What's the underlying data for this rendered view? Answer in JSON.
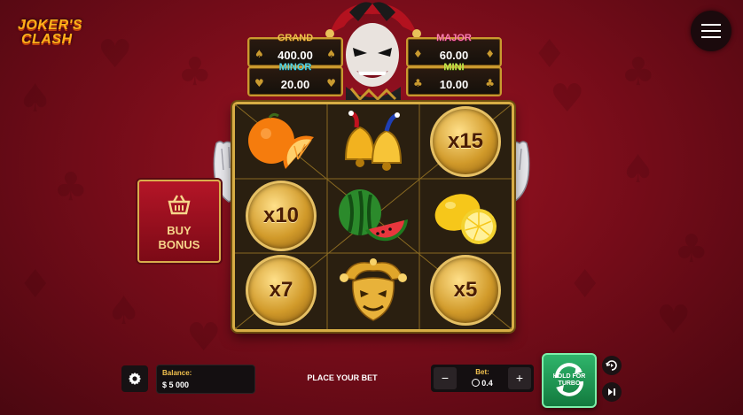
{
  "game": {
    "logo_line1": "JOKER'S",
    "logo_line2": "CLASH"
  },
  "jackpots": [
    {
      "name": "GRAND",
      "value": "400.00",
      "color": "#f2c14e",
      "icon": "spade-icon"
    },
    {
      "name": "MAJOR",
      "value": "60.00",
      "color": "#ff7fb0",
      "icon": "diamond-icon"
    },
    {
      "name": "MINOR",
      "value": "20.00",
      "color": "#55d6e6",
      "icon": "heart-icon"
    },
    {
      "name": "MINI",
      "value": "10.00",
      "color": "#c7f04f",
      "icon": "club-icon"
    }
  ],
  "reels": [
    [
      "orange",
      "coin",
      "coin"
    ],
    [
      "bells",
      "watermelon",
      "joker-mask"
    ],
    [
      "coin",
      "lemon",
      "coin"
    ]
  ],
  "coin_labels": {
    "r0c0": "",
    "c0r1": "x10",
    "c0r2": "x7",
    "c2r0": "x15",
    "c2r2": "x5"
  },
  "buy_bonus": {
    "label_line1": "BUY",
    "label_line2": "BONUS",
    "icon": "basket-icon"
  },
  "footer": {
    "balance_label": "Balance:",
    "balance_value": "$ 5 000",
    "status": "PLACE YOUR BET",
    "bet_label": "Bet:",
    "bet_value": "0.4",
    "minus": "−",
    "plus": "+",
    "spin_line1": "HOLD FOR",
    "spin_line2": "TURBO"
  },
  "colors": {
    "background": "#7a0d1a",
    "gold_frame": "#d7ad45",
    "spin_green": "#2fb56b"
  }
}
